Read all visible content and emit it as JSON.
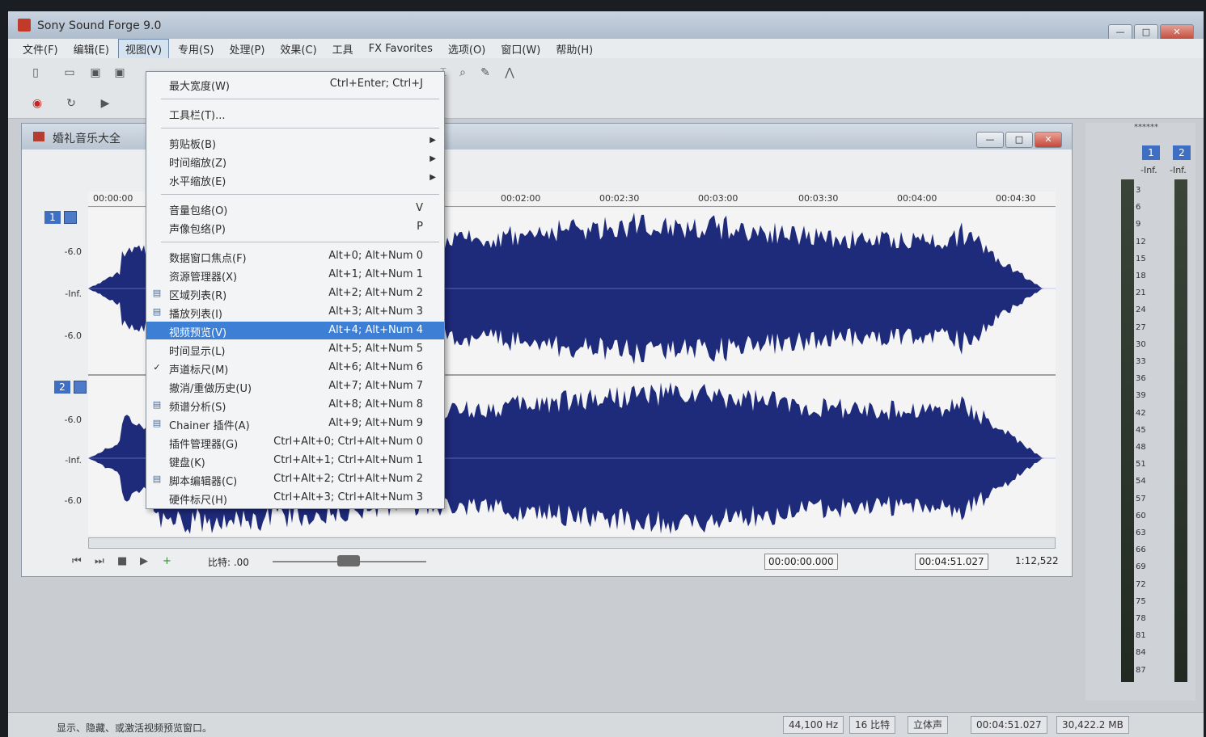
{
  "app": {
    "title": "Sony Sound Forge 9.0"
  },
  "window_buttons": {
    "minimize": "—",
    "maximize": "□",
    "close": "✕"
  },
  "menubar": [
    {
      "label": "文件(F)"
    },
    {
      "label": "编辑(E)"
    },
    {
      "label": "视图(V)",
      "active": true
    },
    {
      "label": "专用(S)"
    },
    {
      "label": "处理(P)"
    },
    {
      "label": "效果(C)"
    },
    {
      "label": "工具"
    },
    {
      "label": "FX Favorites"
    },
    {
      "label": "选项(O)"
    },
    {
      "label": "窗口(W)"
    },
    {
      "label": "帮助(H)"
    }
  ],
  "document": {
    "title": "婚礼音乐大全",
    "ruler_ticks": [
      "00:00:00",
      "00:02:00",
      "00:02:30",
      "00:03:00",
      "00:03:30",
      "00:04:00",
      "00:04:30"
    ],
    "channels": [
      {
        "num": "1",
        "db_top": "-6.0",
        "db_mid": "-Inf.",
        "db_bot": "-6.0"
      },
      {
        "num": "2",
        "db_top": "-6.0",
        "db_mid": "-Inf.",
        "db_bot": "-6.0"
      }
    ],
    "rate_label": "比特: .00",
    "time_current": "00:00:00.000",
    "time_length": "00:04:51.027",
    "zoom_ratio": "1:12,522",
    "waveform_color": "#1e2a7a"
  },
  "view_menu": {
    "items": [
      {
        "type": "item",
        "label": "最大宽度(W)",
        "shortcut": "Ctrl+Enter; Ctrl+J"
      },
      {
        "type": "sep"
      },
      {
        "type": "item",
        "label": "工具栏(T)..."
      },
      {
        "type": "sep"
      },
      {
        "type": "item",
        "label": "剪贴板(B)",
        "submenu": true
      },
      {
        "type": "item",
        "label": "时间缩放(Z)",
        "submenu": true
      },
      {
        "type": "item",
        "label": "水平缩放(E)",
        "submenu": true
      },
      {
        "type": "sep"
      },
      {
        "type": "item",
        "label": "音量包络(O)",
        "shortcut": "V"
      },
      {
        "type": "item",
        "label": "声像包络(P)",
        "shortcut": "P"
      },
      {
        "type": "sep"
      },
      {
        "type": "item",
        "label": "数据窗口焦点(F)",
        "shortcut": "Alt+0; Alt+Num 0"
      },
      {
        "type": "item",
        "label": "资源管理器(X)",
        "shortcut": "Alt+1; Alt+Num 1"
      },
      {
        "type": "item",
        "label": "区域列表(R)",
        "shortcut": "Alt+2; Alt+Num 2",
        "icon": "region-list-icon"
      },
      {
        "type": "item",
        "label": "播放列表(I)",
        "shortcut": "Alt+3; Alt+Num 3",
        "icon": "playlist-icon"
      },
      {
        "type": "item",
        "label": "视频预览(V)",
        "shortcut": "Alt+4; Alt+Num 4",
        "highlighted": true
      },
      {
        "type": "item",
        "label": "时间显示(L)",
        "shortcut": "Alt+5; Alt+Num 5"
      },
      {
        "type": "item",
        "label": "声道标尺(M)",
        "shortcut": "Alt+6; Alt+Num 6",
        "checked": true
      },
      {
        "type": "item",
        "label": "撤消/重做历史(U)",
        "shortcut": "Alt+7; Alt+Num 7"
      },
      {
        "type": "item",
        "label": "频谱分析(S)",
        "shortcut": "Alt+8; Alt+Num 8",
        "icon": "spectrum-icon"
      },
      {
        "type": "item",
        "label": "Chainer 插件(A)",
        "shortcut": "Alt+9; Alt+Num 9",
        "icon": "chainer-icon"
      },
      {
        "type": "item",
        "label": "插件管理器(G)",
        "shortcut": "Ctrl+Alt+0; Ctrl+Alt+Num 0"
      },
      {
        "type": "item",
        "label": "键盘(K)",
        "shortcut": "Ctrl+Alt+1; Ctrl+Alt+Num 1"
      },
      {
        "type": "item",
        "label": "脚本编辑器(C)",
        "shortcut": "Ctrl+Alt+2; Ctrl+Alt+Num 2",
        "icon": "script-icon"
      },
      {
        "type": "item",
        "label": "硬件标尺(H)",
        "shortcut": "Ctrl+Alt+3; Ctrl+Alt+Num 3"
      }
    ]
  },
  "meters": {
    "header": "******",
    "channels": [
      {
        "num": "1",
        "peak": "-Inf."
      },
      {
        "num": "2",
        "peak": "-Inf."
      }
    ],
    "scale": [
      "3",
      "6",
      "9",
      "12",
      "15",
      "18",
      "21",
      "24",
      "27",
      "30",
      "33",
      "36",
      "39",
      "42",
      "45",
      "48",
      "51",
      "54",
      "57",
      "60",
      "63",
      "66",
      "69",
      "72",
      "75",
      "78",
      "81",
      "84",
      "87"
    ]
  },
  "statusbar": {
    "text": "显示、隐藏、或激活视频预览窗口。",
    "sample_rate": "44,100 Hz",
    "bit_depth": "16 比特",
    "channels": "立体声",
    "length": "00:04:51.027",
    "free_space": "30,422.2 MB"
  }
}
